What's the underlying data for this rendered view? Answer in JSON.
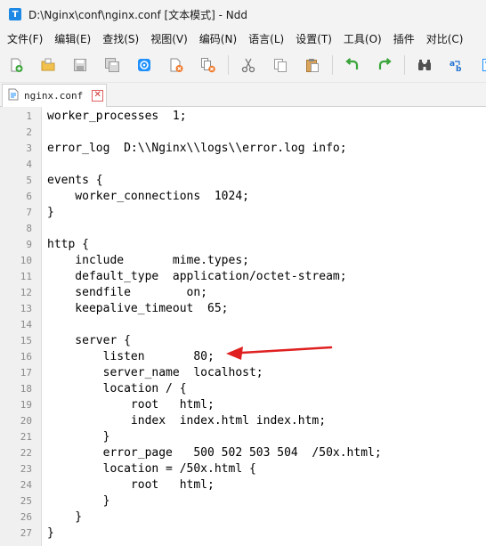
{
  "window": {
    "title": "D:\\Nginx\\conf\\nginx.conf [文本模式] - Ndd",
    "app_icon_letter": "T"
  },
  "menu": [
    "文件(F)",
    "编辑(E)",
    "查找(S)",
    "视图(V)",
    "编码(N)",
    "语言(L)",
    "设置(T)",
    "工具(O)",
    "插件",
    "对比(C)"
  ],
  "toolbar_icons": [
    "new-file-icon",
    "open-folder-icon",
    "save-icon",
    "save-all-icon",
    "settings-circle-icon",
    "close-file-icon",
    "close-all-icon",
    "cut-icon",
    "copy-icon",
    "paste-icon",
    "undo-icon",
    "redo-icon",
    "find-icon",
    "replace-icon",
    "text-mode-icon"
  ],
  "tab": {
    "label": "nginx.conf",
    "close": "✕"
  },
  "editor": {
    "lines": [
      {
        "n": "1",
        "t": "worker_processes  1;"
      },
      {
        "n": "2",
        "t": ""
      },
      {
        "n": "3",
        "t": "error_log  D:\\\\Nginx\\\\logs\\\\error.log info;"
      },
      {
        "n": "4",
        "t": ""
      },
      {
        "n": "5",
        "t": "events {"
      },
      {
        "n": "6",
        "t": "    worker_connections  1024;"
      },
      {
        "n": "7",
        "t": "}"
      },
      {
        "n": "8",
        "t": ""
      },
      {
        "n": "9",
        "t": "http {"
      },
      {
        "n": "10",
        "t": "    include       mime.types;"
      },
      {
        "n": "11",
        "t": "    default_type  application/octet-stream;"
      },
      {
        "n": "12",
        "t": "    sendfile        on;"
      },
      {
        "n": "13",
        "t": "    keepalive_timeout  65;"
      },
      {
        "n": "14",
        "t": ""
      },
      {
        "n": "15",
        "t": "    server {"
      },
      {
        "n": "16",
        "t": "        listen       80;"
      },
      {
        "n": "17",
        "t": "        server_name  localhost;"
      },
      {
        "n": "18",
        "t": "        location / {"
      },
      {
        "n": "19",
        "t": "            root   html;"
      },
      {
        "n": "20",
        "t": "            index  index.html index.htm;"
      },
      {
        "n": "21",
        "t": "        }"
      },
      {
        "n": "22",
        "t": "        error_page   500 502 503 504  /50x.html;"
      },
      {
        "n": "23",
        "t": "        location = /50x.html {"
      },
      {
        "n": "24",
        "t": "            root   html;"
      },
      {
        "n": "25",
        "t": "        }"
      },
      {
        "n": "26",
        "t": "    }"
      },
      {
        "n": "27",
        "t": "}"
      }
    ]
  },
  "annotation": {
    "type": "red-arrow",
    "points_to_line": "16",
    "color": "#e02020"
  }
}
